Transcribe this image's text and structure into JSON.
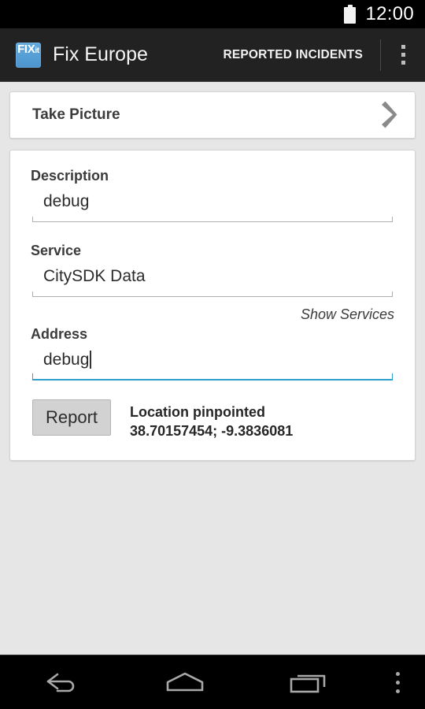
{
  "status_bar": {
    "clock": "12:00",
    "battery_icon": "battery-full-icon"
  },
  "action_bar": {
    "app_icon_primary": "FIX",
    "app_icon_secondary": "it",
    "app_icon_name": "fixit-logo-icon",
    "title": "Fix Europe",
    "action_label": "REPORTED INCIDENTS",
    "overflow_icon": "overflow-menu-icon",
    "background_color": "#222222"
  },
  "take_picture": {
    "label": "Take Picture",
    "chevron_icon": "chevron-right-icon"
  },
  "form": {
    "description": {
      "label": "Description",
      "value": "debug",
      "placeholder": "Description",
      "focused": false
    },
    "service": {
      "label": "Service",
      "value": "CitySDK Data",
      "placeholder": "Service",
      "focused": false
    },
    "show_services_link": "Show Services",
    "address": {
      "label": "Address",
      "value": "debug",
      "placeholder": "Address",
      "focused": true
    },
    "report_button": "Report",
    "location": {
      "status": "Location pinpointed",
      "coordinates": "38.70157454; -9.3836081",
      "latitude": "38.70157454",
      "longitude": "-9.3836081"
    }
  },
  "colors": {
    "accent_focus": "#2f9fcf",
    "underline_normal": "#aeaeae",
    "page_background": "#e6e6e6",
    "card_background": "#ffffff",
    "app_icon_blue": "#4c95cf"
  },
  "nav_bar": {
    "back_icon": "back-arrow-icon",
    "home_icon": "home-icon",
    "recents_icon": "recent-apps-icon",
    "overflow_icon": "overflow-menu-icon"
  }
}
